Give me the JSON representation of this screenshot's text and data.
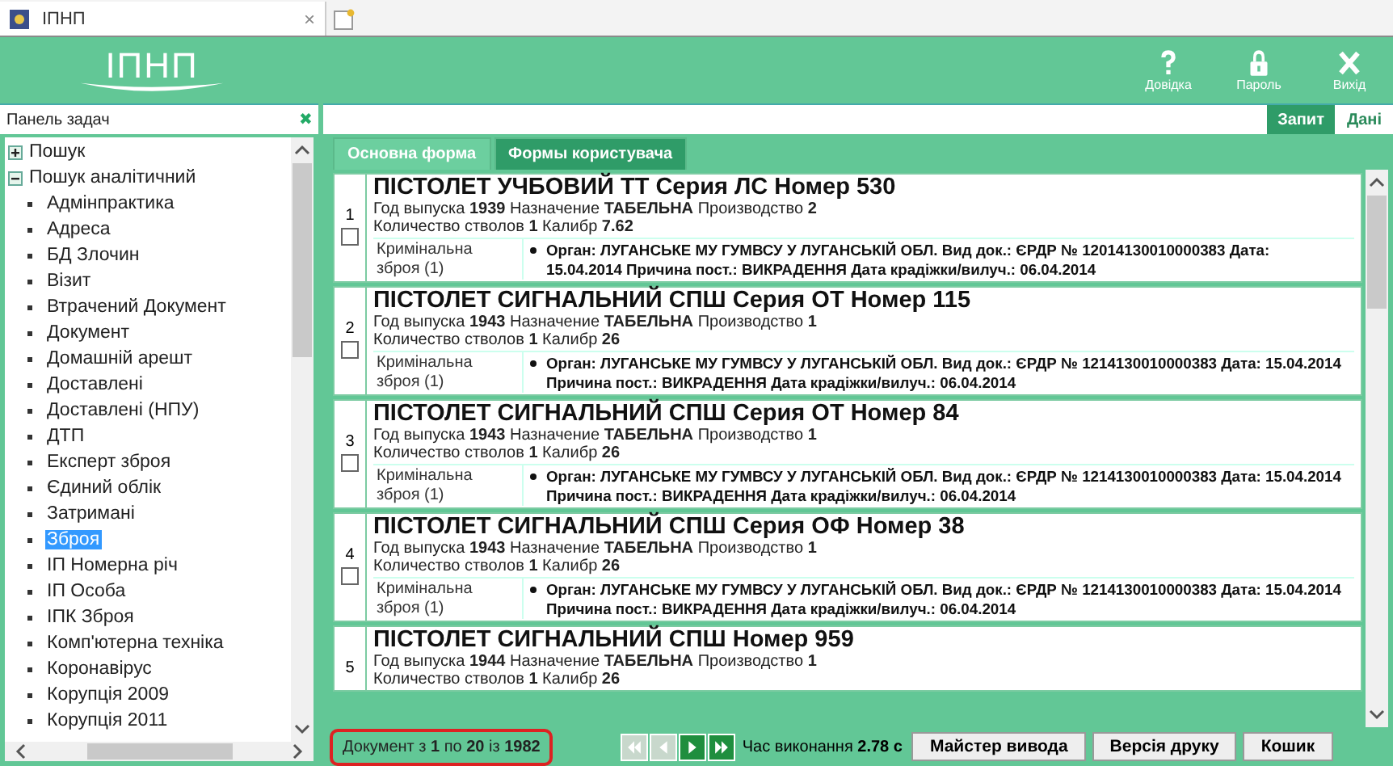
{
  "browser_tab": {
    "title": "ІПНП",
    "close": "×"
  },
  "header": {
    "logo": "ІПНП",
    "actions": [
      {
        "kind": "help",
        "label": "Довідка"
      },
      {
        "kind": "lock",
        "label": "Пароль"
      },
      {
        "kind": "exit",
        "label": "Вихід"
      }
    ]
  },
  "mode_tabs": [
    {
      "label": "Запит",
      "selected": true
    },
    {
      "label": "Дані",
      "selected": false
    }
  ],
  "sidebar": {
    "title": "Панель задач",
    "close": "✖",
    "items": [
      {
        "label": "Пошук",
        "expanded": false,
        "selected": false
      },
      {
        "label": "Пошук аналітичний",
        "expanded": true,
        "selected": false,
        "children": [
          {
            "label": "Адмінпрактика",
            "selected": false
          },
          {
            "label": "Адреса",
            "selected": false
          },
          {
            "label": "БД Злочин",
            "selected": false
          },
          {
            "label": "Візит",
            "selected": false
          },
          {
            "label": "Втрачений Документ",
            "selected": false
          },
          {
            "label": "Документ",
            "selected": false
          },
          {
            "label": "Домашній арешт",
            "selected": false
          },
          {
            "label": "Доставлені",
            "selected": false
          },
          {
            "label": "Доставлені (НПУ)",
            "selected": false
          },
          {
            "label": "ДТП",
            "selected": false
          },
          {
            "label": "Експерт зброя",
            "selected": false
          },
          {
            "label": "Єдиний облік",
            "selected": false
          },
          {
            "label": "Затримані",
            "selected": false
          },
          {
            "label": "Зброя",
            "selected": true
          },
          {
            "label": "ІП Номерна річ",
            "selected": false
          },
          {
            "label": "ІП Особа",
            "selected": false
          },
          {
            "label": "ІПК Зброя",
            "selected": false
          },
          {
            "label": "Комп'ютерна техніка",
            "selected": false
          },
          {
            "label": "Коронавірус",
            "selected": false
          },
          {
            "label": "Корупція 2009",
            "selected": false
          },
          {
            "label": "Корупція 2011",
            "selected": false
          }
        ]
      }
    ]
  },
  "form_tabs": [
    {
      "label": "Основна форма",
      "selected": false
    },
    {
      "label": "Формы користувача",
      "selected": true
    }
  ],
  "records": [
    {
      "number": "1",
      "checked": false,
      "title": "ПІСТОЛЕТ УЧБОВИЙ ТТ Серия ЛС Номер 530",
      "line_1": "Год выпуска **1939** Назначение **ТАБЕЛЬНА** Производство **2**",
      "line_2": "Количество стволов **1** Калибр **7.62**",
      "category": "Кримінальна зброя (1)",
      "detail": "Орган: ЛУГАНСЬКЕ МУ ГУМВСУ У ЛУГАНСЬКІЙ ОБЛ. Вид док.: ЄРДР № 12014130010000383 Дата: 15.04.2014 Причина пост.: ВИКРАДЕННЯ Дата крадіжки/вилуч.: 06.04.2014"
    },
    {
      "number": "2",
      "checked": false,
      "title": "ПІСТОЛЕТ СИГНАЛЬНИЙ СПШ Серия ОТ Номер 115",
      "line_1": "Год выпуска **1943** Назначение **ТАБЕЛЬНА** Производство **1**",
      "line_2": "Количество стволов **1** Калибр **26**",
      "category": "Кримінальна зброя (1)",
      "detail": "Орган: ЛУГАНСЬКЕ МУ ГУМВСУ У ЛУГАНСЬКІЙ ОБЛ. Вид док.: ЄРДР № 1214130010000383 Дата: 15.04.2014 Причина пост.: ВИКРАДЕННЯ Дата крадіжки/вилуч.: 06.04.2014"
    },
    {
      "number": "3",
      "checked": false,
      "title": "ПІСТОЛЕТ СИГНАЛЬНИЙ СПШ Серия ОТ Номер 84",
      "line_1": "Год выпуска **1943** Назначение **ТАБЕЛЬНА** Производство **1**",
      "line_2": "Количество стволов **1** Калибр **26**",
      "category": "Кримінальна зброя (1)",
      "detail": "Орган: ЛУГАНСЬКЕ МУ ГУМВСУ У ЛУГАНСЬКІЙ ОБЛ. Вид док.: ЄРДР № 1214130010000383 Дата: 15.04.2014 Причина пост.: ВИКРАДЕННЯ Дата крадіжки/вилуч.: 06.04.2014"
    },
    {
      "number": "4",
      "checked": false,
      "title": "ПІСТОЛЕТ СИГНАЛЬНИЙ СПШ Серия ОФ Номер 38",
      "line_1": "Год выпуска **1943** Назначение **ТАБЕЛЬНА** Производство **1**",
      "line_2": "Количество стволов **1** Калибр **26**",
      "category": "Кримінальна зброя (1)",
      "detail": "Орган: ЛУГАНСЬКЕ МУ ГУМВСУ У ЛУГАНСЬКІЙ ОБЛ. Вид док.: ЄРДР № 1214130010000383 Дата: 15.04.2014 Причина пост.: ВИКРАДЕННЯ Дата крадіжки/вилуч.: 06.04.2014"
    },
    {
      "number": "5",
      "title": "ПІСТОЛЕТ СИГНАЛЬНИЙ СПШ Номер 959",
      "line_1": "Год выпуска **1944** Назначение **ТАБЕЛЬНА** Производство **1**",
      "line_2": "Количество стволов **1** Калибр **26**"
    }
  ],
  "footer": {
    "counter": "Документ з **1** по **20** із **1982**",
    "pager": [
      {
        "kind": "first",
        "disabled": true
      },
      {
        "kind": "prev",
        "disabled": true
      },
      {
        "kind": "next",
        "disabled": false
      },
      {
        "kind": "last",
        "disabled": false
      }
    ],
    "timing": "Час виконання **2.78 с**",
    "buttons": [
      "Майстер вивода",
      "Версія друку",
      "Кошик"
    ]
  }
}
